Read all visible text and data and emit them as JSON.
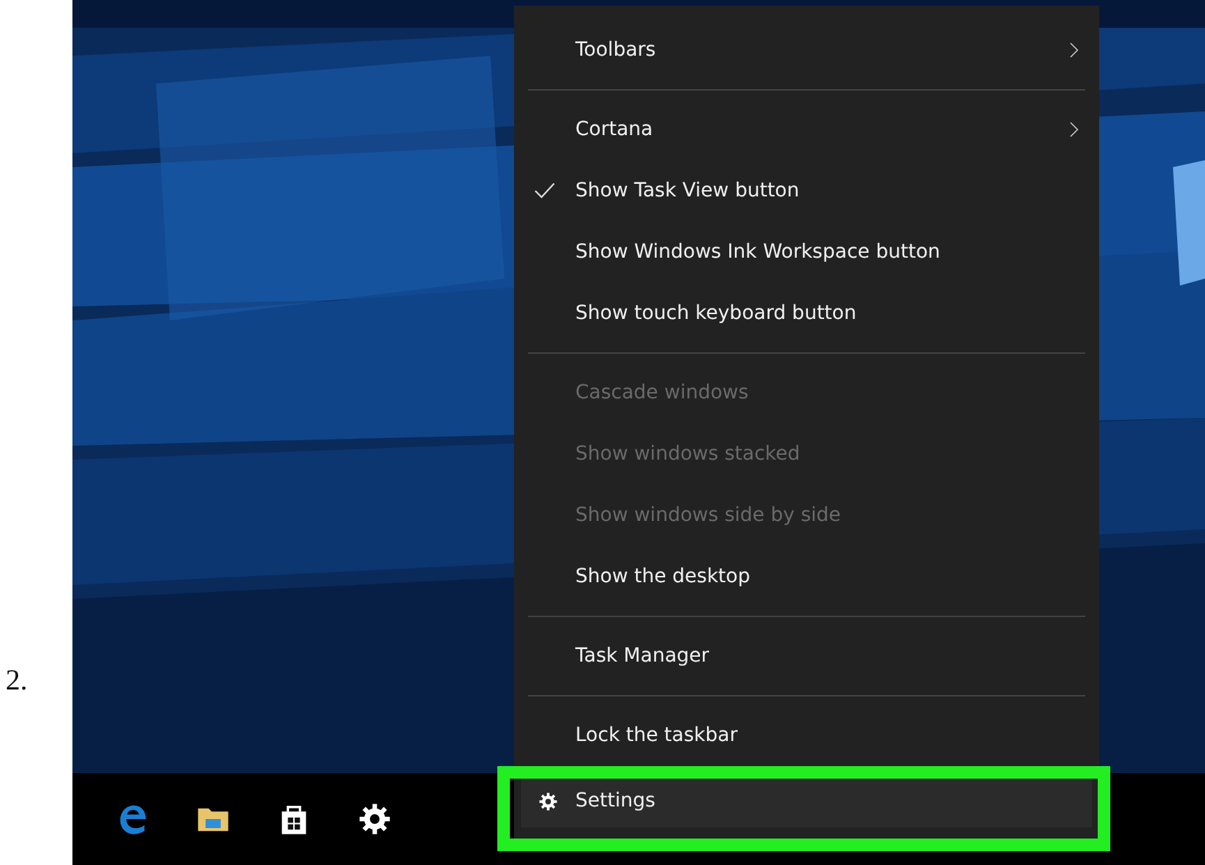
{
  "step_label": "2.",
  "menu": [
    {
      "kind": "item",
      "label": "Toolbars",
      "submenu": true,
      "checked": false,
      "disabled": false,
      "selected": false
    },
    {
      "kind": "separator"
    },
    {
      "kind": "item",
      "label": "Cortana",
      "submenu": true,
      "checked": false,
      "disabled": false,
      "selected": false
    },
    {
      "kind": "item",
      "label": "Show Task View button",
      "submenu": false,
      "checked": true,
      "disabled": false,
      "selected": false
    },
    {
      "kind": "item",
      "label": "Show Windows Ink Workspace button",
      "submenu": false,
      "checked": false,
      "disabled": false,
      "selected": false
    },
    {
      "kind": "item",
      "label": "Show touch keyboard button",
      "submenu": false,
      "checked": false,
      "disabled": false,
      "selected": false
    },
    {
      "kind": "separator"
    },
    {
      "kind": "item",
      "label": "Cascade windows",
      "submenu": false,
      "checked": false,
      "disabled": true,
      "selected": false
    },
    {
      "kind": "item",
      "label": "Show windows stacked",
      "submenu": false,
      "checked": false,
      "disabled": true,
      "selected": false
    },
    {
      "kind": "item",
      "label": "Show windows side by side",
      "submenu": false,
      "checked": false,
      "disabled": true,
      "selected": false
    },
    {
      "kind": "item",
      "label": "Show the desktop",
      "submenu": false,
      "checked": false,
      "disabled": false,
      "selected": false
    },
    {
      "kind": "separator"
    },
    {
      "kind": "item",
      "label": "Task Manager",
      "submenu": false,
      "checked": false,
      "disabled": false,
      "selected": false
    },
    {
      "kind": "separator"
    },
    {
      "kind": "item",
      "label": "Lock the taskbar",
      "submenu": false,
      "checked": false,
      "disabled": false,
      "selected": false
    },
    {
      "kind": "gear_item",
      "label": "Settings",
      "submenu": false,
      "checked": false,
      "disabled": false,
      "selected": true
    }
  ]
}
